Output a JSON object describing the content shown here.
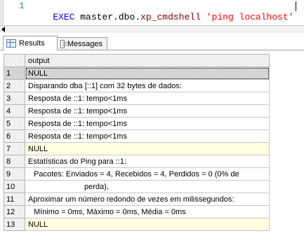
{
  "editor": {
    "line_number": "1",
    "code": {
      "keyword": "EXEC",
      "object": "master.dbo.",
      "procedure": "xp_cmdshell",
      "string": "'ping localhost'"
    }
  },
  "tabs": {
    "results": "Results",
    "messages": "Messages"
  },
  "grid": {
    "column_header": "output",
    "rows": [
      {
        "n": "1",
        "text": "NULL"
      },
      {
        "n": "2",
        "text": "Disparando dba [::1] com 32 bytes de dados:"
      },
      {
        "n": "3",
        "text": "Resposta de ::1: tempo<1ms"
      },
      {
        "n": "4",
        "text": "Resposta de ::1: tempo<1ms"
      },
      {
        "n": "5",
        "text": "Resposta de ::1: tempo<1ms"
      },
      {
        "n": "6",
        "text": "Resposta de ::1: tempo<1ms"
      },
      {
        "n": "7",
        "text": "NULL"
      },
      {
        "n": "8",
        "text": "Estatísticas do Ping para ::1:"
      },
      {
        "n": "9",
        "text": "Pacotes: Enviados = 4, Recebidos = 4, Perdidos = 0 (0% de perda),"
      },
      {
        "n": "11",
        "text": "Aproximar um número redondo de vezes em milissegundos:"
      },
      {
        "n": "12",
        "text": "Mínimo = 0ms, Máximo = 0ms, Média = 0ms"
      },
      {
        "n": "13",
        "text": "NULL"
      }
    ],
    "row10_number": "10",
    "row10_text": "perda),",
    "row9_text": "Pacotes: Enviados = 4, Recebidos = 4, Perdidos = 0 (0% de"
  },
  "colors": {
    "null_highlight": "#ffffe1",
    "selected_row": "#d4d4d4",
    "keyword": "#0000ff",
    "string": "#ff0000",
    "procedure": "#800000"
  }
}
